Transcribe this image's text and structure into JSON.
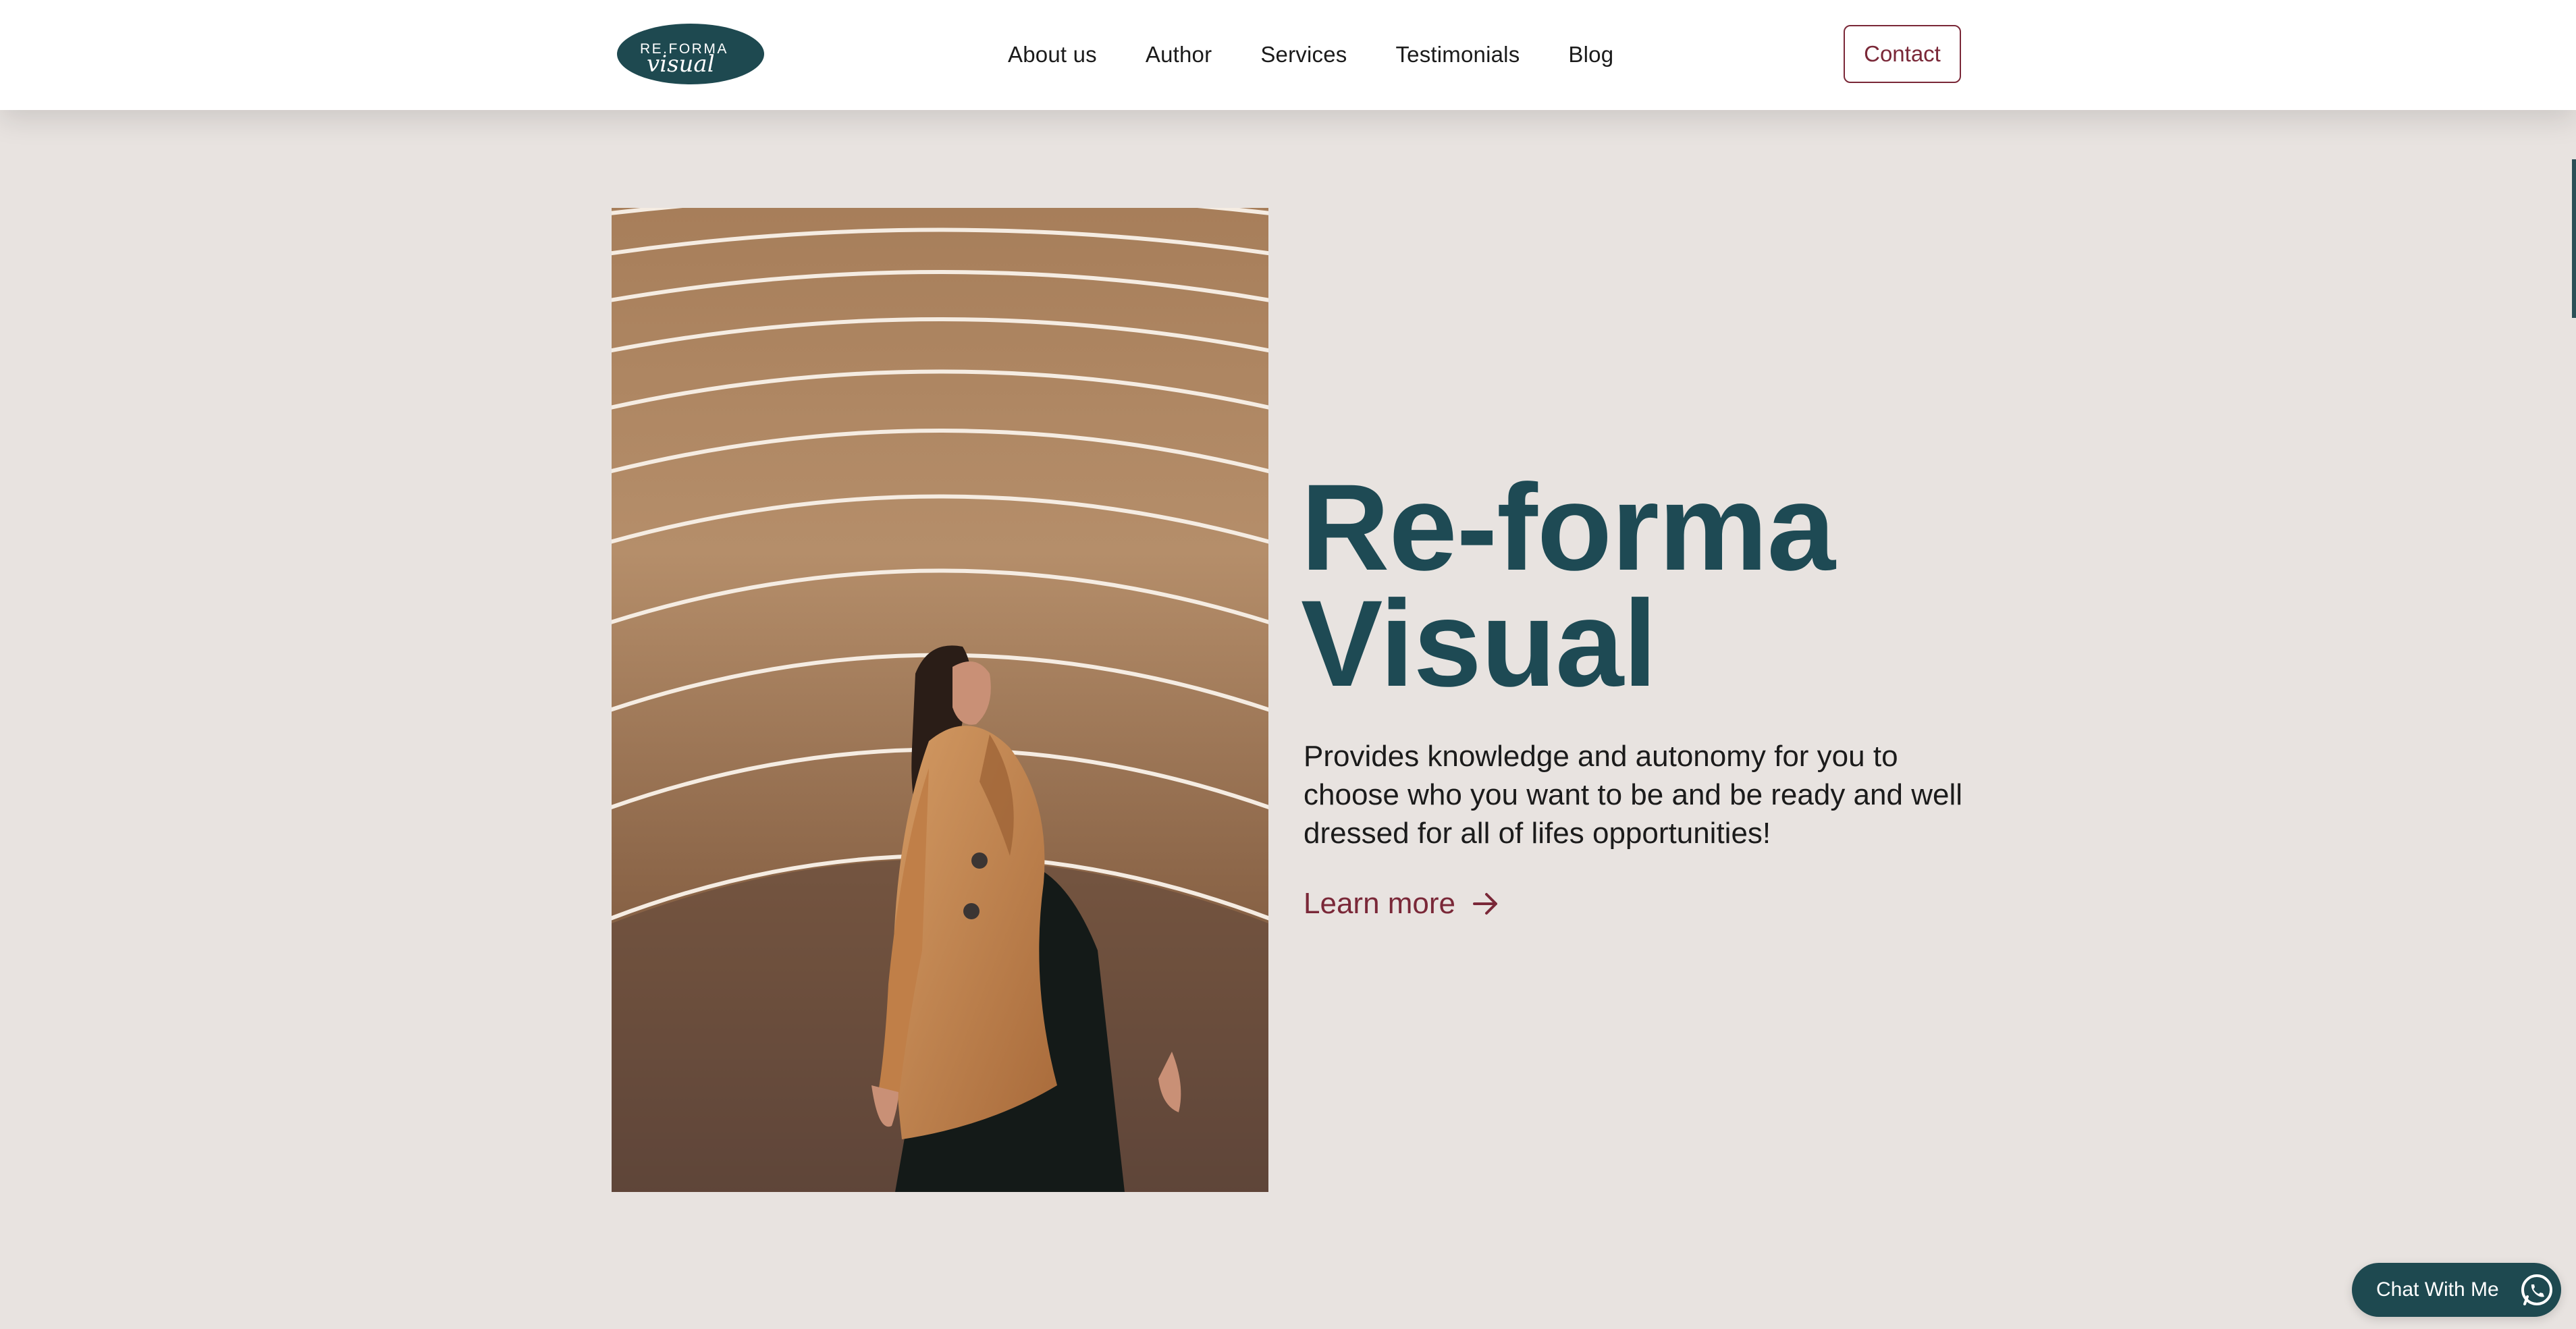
{
  "header": {
    "logo": {
      "line1": "RE.FORMA",
      "line2": "visual"
    },
    "nav": [
      "About us",
      "Author",
      "Services",
      "Testimonials",
      "Blog"
    ],
    "contact_label": "Contact"
  },
  "hero": {
    "image_icon": "woman-in-camel-coat-photo",
    "title_line1": "Re-forma",
    "title_line2": "Visual",
    "description": "Provides knowledge and autonomy for you to choose who you want to be and be ready and well dressed for all of lifes opportunities!",
    "learn_more_label": "Learn more",
    "learn_more_icon": "arrow-right-icon"
  },
  "chat_widget": {
    "label": "Chat With Me",
    "icon": "whatsapp-icon"
  },
  "colors": {
    "background": "#e8e3e0",
    "brand_teal": "#1e4950",
    "accent_burgundy": "#7a2838"
  }
}
